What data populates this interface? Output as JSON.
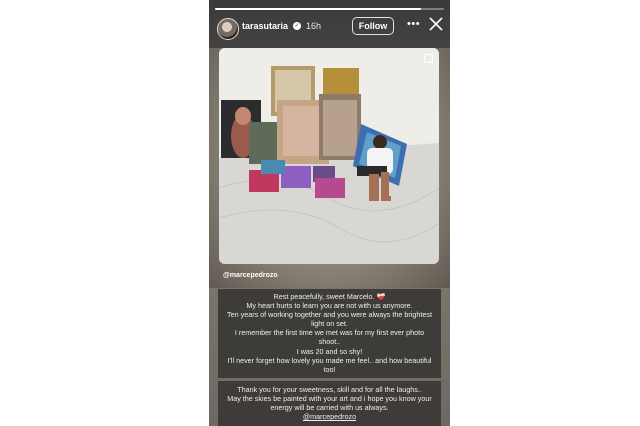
{
  "story": {
    "progress": 0.9,
    "username": "tarasutaria",
    "verified": true,
    "time_ago": "16h",
    "follow_label": "Follow",
    "more_icon": "ellipsis-icon",
    "close_icon": "close-icon"
  },
  "photo": {
    "mention": "@marcepedrozo",
    "save_icon": "bookmark-icon"
  },
  "caption": {
    "lines": [
      "Rest peacefully, sweet Marcelo. ❤️‍🩹",
      "My heart hurts to learn you are not with us anymore.",
      "Ten years of working together and you were always the brightest light on set.",
      "I remember the first time we met was for my first ever photo shoot..",
      "I was 20 and so shy!",
      "I'll never forget how lovely you made me feel.. and how beautiful too!"
    ]
  },
  "thanks": {
    "lines": [
      "Thank you for your sweetness, skill and for all the laughs..",
      "May the skies be painted with your art and i hope you know your energy will be carried with us always."
    ],
    "mention": "@marcepedrozo"
  },
  "colors": {
    "caption_bg": "#3a3734",
    "text": "#eeeeee"
  }
}
